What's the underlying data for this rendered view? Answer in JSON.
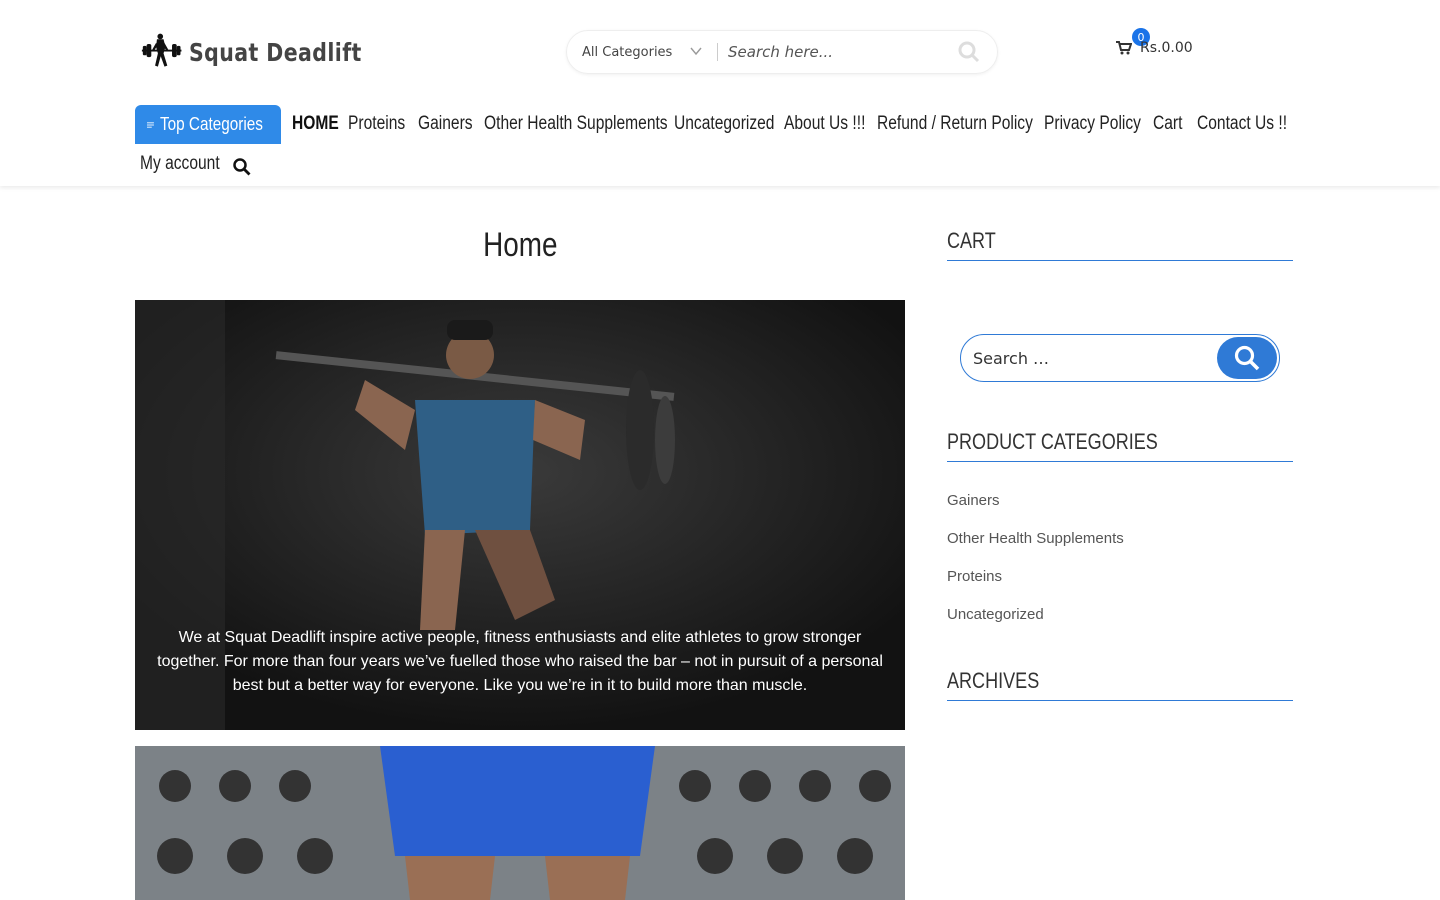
{
  "brand": {
    "name": "Squat Deadlift"
  },
  "search": {
    "category": "All Categories",
    "placeholder": "Search here..."
  },
  "cart": {
    "count": "0",
    "total": "Rs.0.00"
  },
  "nav": {
    "top_categories": "Top Categories",
    "items": [
      "HOME",
      "Proteins",
      "Gainers",
      "Other Health Supplements",
      "Uncategorized",
      "About Us !!!",
      "Refund / Return Policy",
      "Privacy Policy",
      "Cart",
      "Contact Us !!"
    ],
    "second_row": "My account"
  },
  "main": {
    "title": "Home",
    "hero_text": "We at Squat Deadlift inspire active people, fitness enthusiasts and elite athletes to grow stronger together. For more than four years we’ve fuelled those who raised the bar – not in pursuit of a personal best but a better way for everyone. Like you we’re in it to build more than muscle."
  },
  "sidebar": {
    "cart_title": "CART",
    "search_placeholder": "Search …",
    "categories_title": "PRODUCT CATEGORIES",
    "categories": [
      "Gainers",
      "Other Health Supplements",
      "Proteins",
      "Uncategorized"
    ],
    "archives_title": "ARCHIVES"
  },
  "colors": {
    "accent": "#2f8ae8",
    "badge": "#1a73e8",
    "underline": "#2f7ad6"
  },
  "icons": [
    "barbell-logo-icon",
    "chevron-down-icon",
    "search-icon",
    "cart-icon",
    "menu-lines-icon"
  ]
}
